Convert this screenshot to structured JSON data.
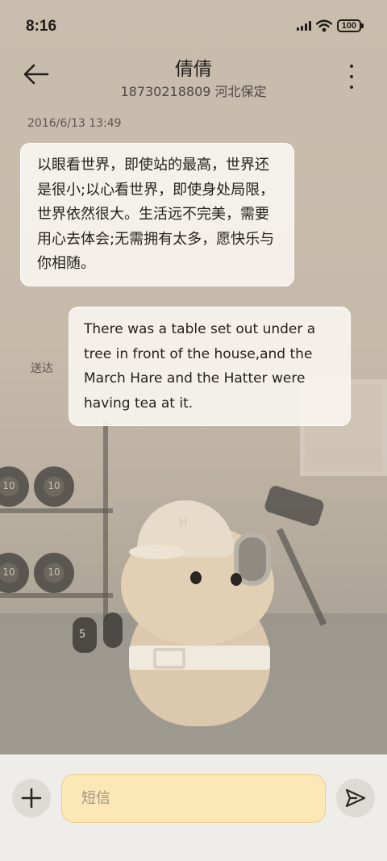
{
  "status_bar": {
    "time": "8:16",
    "battery": "100"
  },
  "header": {
    "contact_name": "倩倩",
    "contact_detail": "18730218809 河北保定"
  },
  "conversation": {
    "timestamp": "2016/6/13 13:49",
    "messages": [
      {
        "direction": "incoming",
        "text": "以眼看世界，即使站的最高，世界还是很小;以心看世界，即使身处局限，世界依然很大。生活远不完美，需要用心去体会;无需拥有太多，愿快乐与你相随。"
      },
      {
        "direction": "outgoing",
        "text": "There was a table set out under a tree in front of the house,and the March Hare and the Hatter were having tea at it.",
        "status": "送达"
      }
    ]
  },
  "composer": {
    "placeholder": "短信",
    "value": ""
  },
  "wallpaper": {
    "plate_labels": [
      "10",
      "10",
      "10",
      "10"
    ],
    "dumbbell_label": "5",
    "cap_letter": "H"
  },
  "colors": {
    "input_background": "#fbe8b6",
    "input_border": "#e9cd86",
    "bubble_background": "#f7f4ef",
    "composer_background": "#efedea"
  },
  "icons": {
    "back": "arrow-left-icon",
    "more": "more-vertical-icon",
    "add": "plus-icon",
    "send": "send-icon",
    "wifi": "wifi-icon",
    "signal": "signal-icon",
    "battery": "battery-icon"
  }
}
